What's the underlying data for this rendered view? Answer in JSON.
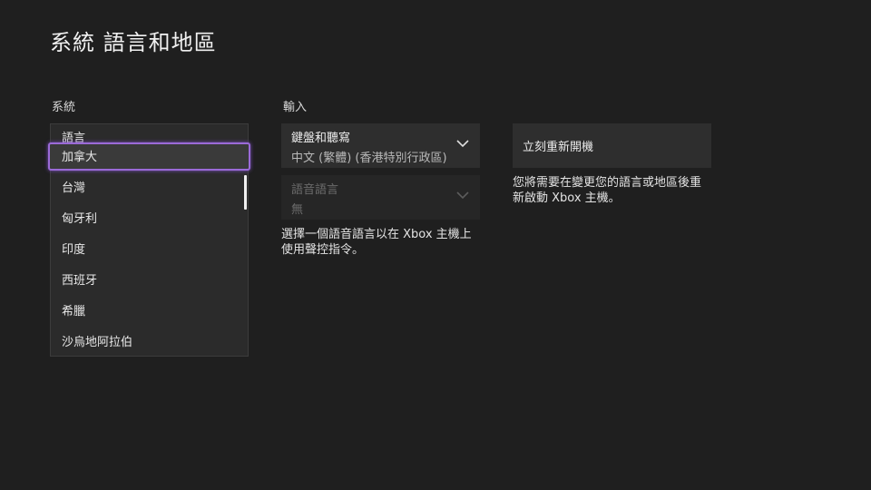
{
  "page": {
    "title": "系統 語言和地區"
  },
  "system": {
    "section_label": "系統",
    "dropdown_label": "語言",
    "options": [
      {
        "label": "加拿大",
        "selected": true
      },
      {
        "label": "台灣",
        "selected": false
      },
      {
        "label": "匈牙利",
        "selected": false
      },
      {
        "label": "印度",
        "selected": false
      },
      {
        "label": "西班牙",
        "selected": false
      },
      {
        "label": "希臘",
        "selected": false
      },
      {
        "label": "沙烏地阿拉伯",
        "selected": false
      }
    ]
  },
  "input": {
    "section_label": "輸入",
    "keyboard": {
      "label": "鍵盤和聽寫",
      "value": "中文 (繁體) (香港特別行政區)",
      "icon": "chevron-down-icon"
    },
    "speech": {
      "label": "語音語言",
      "value": "無",
      "icon": "chevron-down-icon",
      "disabled": true
    },
    "description_line1": "選擇一個語音語言以在 Xbox 主機上",
    "description_line2": "使用聲控指令。"
  },
  "restart": {
    "button_label": "立刻重新開機",
    "description_line1": "您將需要在變更您的語言或地區後重",
    "description_line2": "新啟動 Xbox 主機。"
  },
  "colors": {
    "background": "#1f1f1f",
    "tile": "#2e2e2e",
    "focus": "#9b6ad8"
  }
}
